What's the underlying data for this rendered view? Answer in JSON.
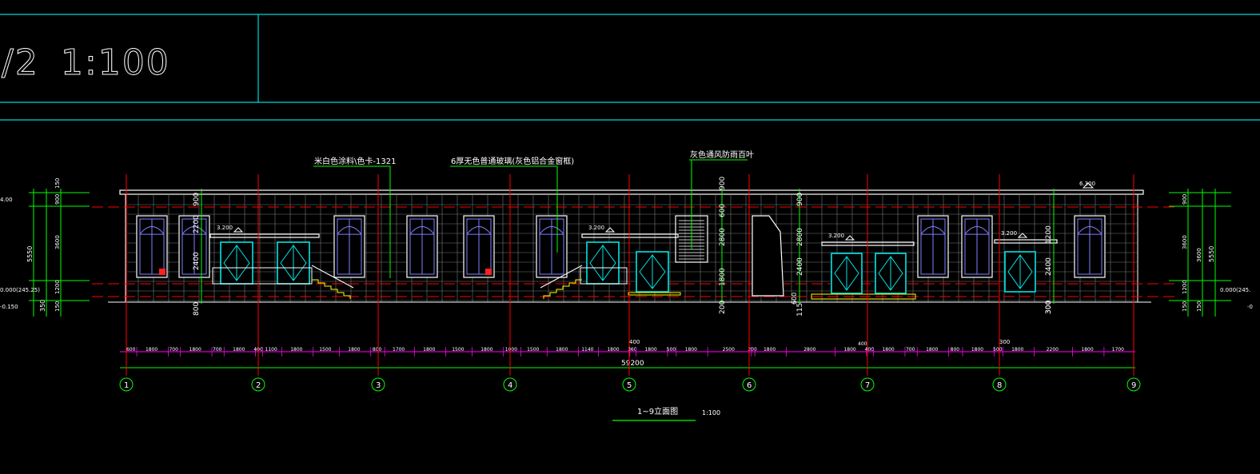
{
  "header": {
    "title_fragment": "/2",
    "title_scale": "1:100"
  },
  "annotations": {
    "wall_finish": "米白色涂料\\色卡-1321",
    "glass_note": "6厚无色普通玻璃(灰色铝合金窗框)",
    "louver_note": "灰色通风防雨百叶"
  },
  "drawing": {
    "caption": "1~9立面图",
    "caption_scale": "1:100",
    "total_dimension": "59200",
    "roof_level": "6.300",
    "canopy_levels": [
      "3.200",
      "3.200",
      "3.200",
      "3.200"
    ]
  },
  "axes": [
    "1",
    "2",
    "3",
    "4",
    "5",
    "6",
    "7",
    "8",
    "9"
  ],
  "dimension_segments": [
    "600",
    "1800",
    "700",
    "1800",
    "700",
    "1800",
    "400",
    "1100",
    "1800",
    "1500",
    "1800",
    "800",
    "1700",
    "1800",
    "1500",
    "1800",
    "1000",
    "1500",
    "1800",
    "1140",
    "1800",
    "360",
    "1800",
    "500",
    "1800",
    "2500",
    "200",
    "1800",
    "2800",
    "1800",
    "400",
    "1800",
    "700",
    "1800",
    "800",
    "1800",
    "500",
    "1800",
    "2200",
    "1800",
    "1700"
  ],
  "vertical_dims": {
    "left_outer": [
      "5550",
      "350"
    ],
    "left_inner": [
      "900",
      "3600",
      "1200",
      "150",
      "150"
    ],
    "right_outer": [
      "5550",
      "150"
    ],
    "right_inner": [
      "900",
      "3600",
      "1200",
      "150"
    ],
    "mid_a": [
      "900",
      "2200",
      "2400",
      "800"
    ],
    "mid_b": [
      "900",
      "600",
      "2800",
      "1800",
      "200"
    ],
    "mid_c": [
      "900",
      "2800",
      "2400",
      "115"
    ],
    "mid_d": [
      "1200",
      "2400",
      "300",
      "300"
    ],
    "small_labels": [
      "400",
      "300",
      "400",
      "600"
    ]
  },
  "level_marks": {
    "left_top": "4.00",
    "left_mid": "0.000(245.25)",
    "left_bottom": "-0.150",
    "right_mid": "0.000(245.",
    "right_bottom": "-0"
  },
  "colors": {
    "background": "#000000",
    "frame": "#00d8d8",
    "wall": "#ffffff",
    "axis": "#ff0000",
    "dim": "#ff00ff",
    "leader": "#00ff00",
    "glass": "#00e5e5",
    "stair": "#ffff00",
    "window": "#8080ff"
  }
}
